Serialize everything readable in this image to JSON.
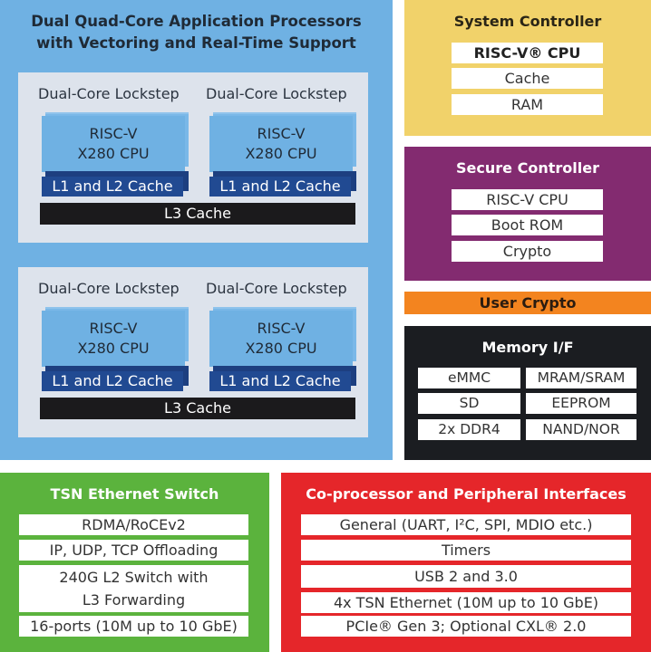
{
  "app_processors": {
    "title_line1": "Dual Quad-Core Application Processors",
    "title_line2": "with Vectoring and Real-Time Support",
    "color": "#6fb1e3",
    "clusters": [
      {
        "lockstep": [
          {
            "label": "Dual-Core Lockstep",
            "cpu_line1": "RISC-V",
            "cpu_line2": "X280 CPU",
            "cache": "L1 and L2 Cache"
          },
          {
            "label": "Dual-Core Lockstep",
            "cpu_line1": "RISC-V",
            "cpu_line2": "X280 CPU",
            "cache": "L1 and L2 Cache"
          }
        ],
        "l3": "L3 Cache"
      },
      {
        "lockstep": [
          {
            "label": "Dual-Core Lockstep",
            "cpu_line1": "RISC-V",
            "cpu_line2": "X280 CPU",
            "cache": "L1 and L2 Cache"
          },
          {
            "label": "Dual-Core Lockstep",
            "cpu_line1": "RISC-V",
            "cpu_line2": "X280 CPU",
            "cache": "L1 and L2 Cache"
          }
        ],
        "l3": "L3 Cache"
      }
    ]
  },
  "system_controller": {
    "title": "System Controller",
    "color": "#f1d26a",
    "items": [
      "RISC-V® CPU",
      "Cache",
      "RAM"
    ]
  },
  "secure_controller": {
    "title": "Secure Controller",
    "color": "#832b70",
    "items": [
      "RISC-V CPU",
      "Boot ROM",
      "Crypto"
    ]
  },
  "user_crypto": {
    "title": "User Crypto",
    "color": "#f3841f"
  },
  "memory_if": {
    "title": "Memory I/F",
    "color": "#1b1d21",
    "rows": [
      [
        "eMMC",
        "MRAM/SRAM"
      ],
      [
        "SD",
        "EEPROM"
      ],
      [
        "2x DDR4",
        "NAND/NOR"
      ]
    ]
  },
  "tsn_switch": {
    "title": "TSN Ethernet Switch",
    "color": "#5bb33d",
    "items": [
      "RDMA/RoCEv2",
      "IP, UDP, TCP Offloading",
      "240G L2 Switch with",
      "L3 Forwarding",
      "16-ports (10M up to 10 GbE)"
    ]
  },
  "coprocessor": {
    "title": "Co-processor and Peripheral Interfaces",
    "color": "#e5262a",
    "items": [
      "General (UART, I²C, SPI, MDIO etc.)",
      "Timers",
      "USB 2 and 3.0",
      "4x TSN Ethernet (10M up to 10 GbE)",
      "PCIe® Gen 3; Optional CXL® 2.0"
    ]
  }
}
